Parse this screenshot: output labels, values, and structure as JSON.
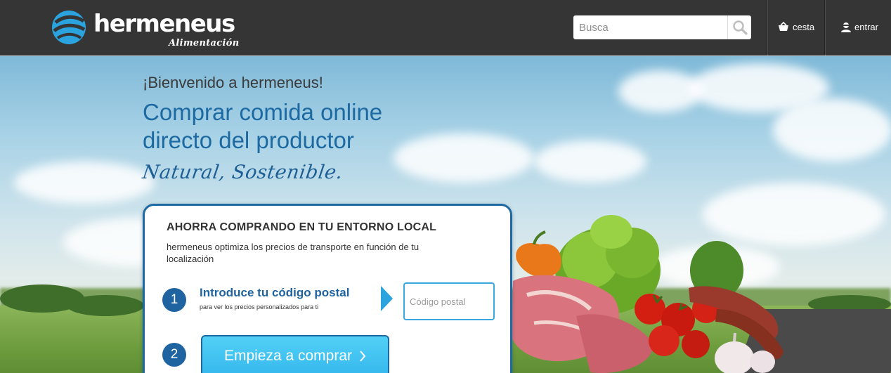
{
  "header": {
    "brand": "hermeneus",
    "brand_sub": "Alimentación",
    "search": {
      "placeholder": "Busca",
      "icon": "magnifier-icon"
    },
    "cart": {
      "label": "cesta",
      "icon": "basket-icon"
    },
    "login": {
      "label": "entrar",
      "icon": "user-icon"
    }
  },
  "hero": {
    "welcome": "¡Bienvenido a hermeneus!",
    "headline": "Comprar comida online directo del productor",
    "tagline": "Natural, Sostenible."
  },
  "card": {
    "title": "AHORRA COMPRANDO EN TU ENTORNO LOCAL",
    "description": "hermeneus optimiza los precios de transporte en función de tu localización",
    "step1": {
      "number": "1",
      "title": "Introduce tu código postal",
      "subtitle": "para ver los precios personalizados para ti",
      "zip_placeholder": "Código postal"
    },
    "step2": {
      "number": "2",
      "button_label": "Empieza a comprar"
    }
  },
  "colors": {
    "header_bg": "#353535",
    "brand_blue": "#1d6aa3",
    "logo_accent": "#2aa3df",
    "cta_bg": "#2fb3ea"
  }
}
